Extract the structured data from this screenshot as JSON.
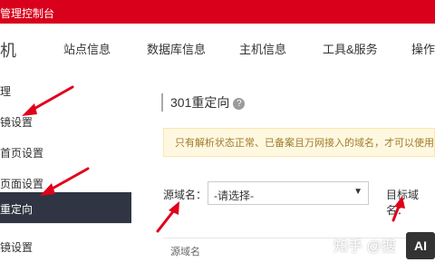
{
  "topbar": {
    "title": "管理控制台"
  },
  "nav": {
    "left_label": "机",
    "items": [
      "站点信息",
      "数据库信息",
      "主机信息",
      "工具&服务",
      "操作"
    ]
  },
  "sidebar": {
    "items": [
      {
        "label": "理"
      },
      {
        "label": "镜设置"
      },
      {
        "label": "首页设置"
      },
      {
        "label": "页面设置"
      },
      {
        "label": "重定向"
      },
      {
        "label": "镜设置"
      }
    ]
  },
  "content": {
    "heading": "301重定向",
    "help_icon": "?",
    "notice": "只有解析状态正常、已备案且万网接入的域名，才可以使用此",
    "source_label": "源域名：",
    "select_value": "-请选择-",
    "target_label": "目标域名：",
    "table_header": "源域名"
  },
  "watermark": "知乎 @搜",
  "ai_badge": "AI",
  "colors": {
    "topbar": "#d9001b",
    "active_sidebar": "#2f3542",
    "arrow": "#e0001b"
  }
}
